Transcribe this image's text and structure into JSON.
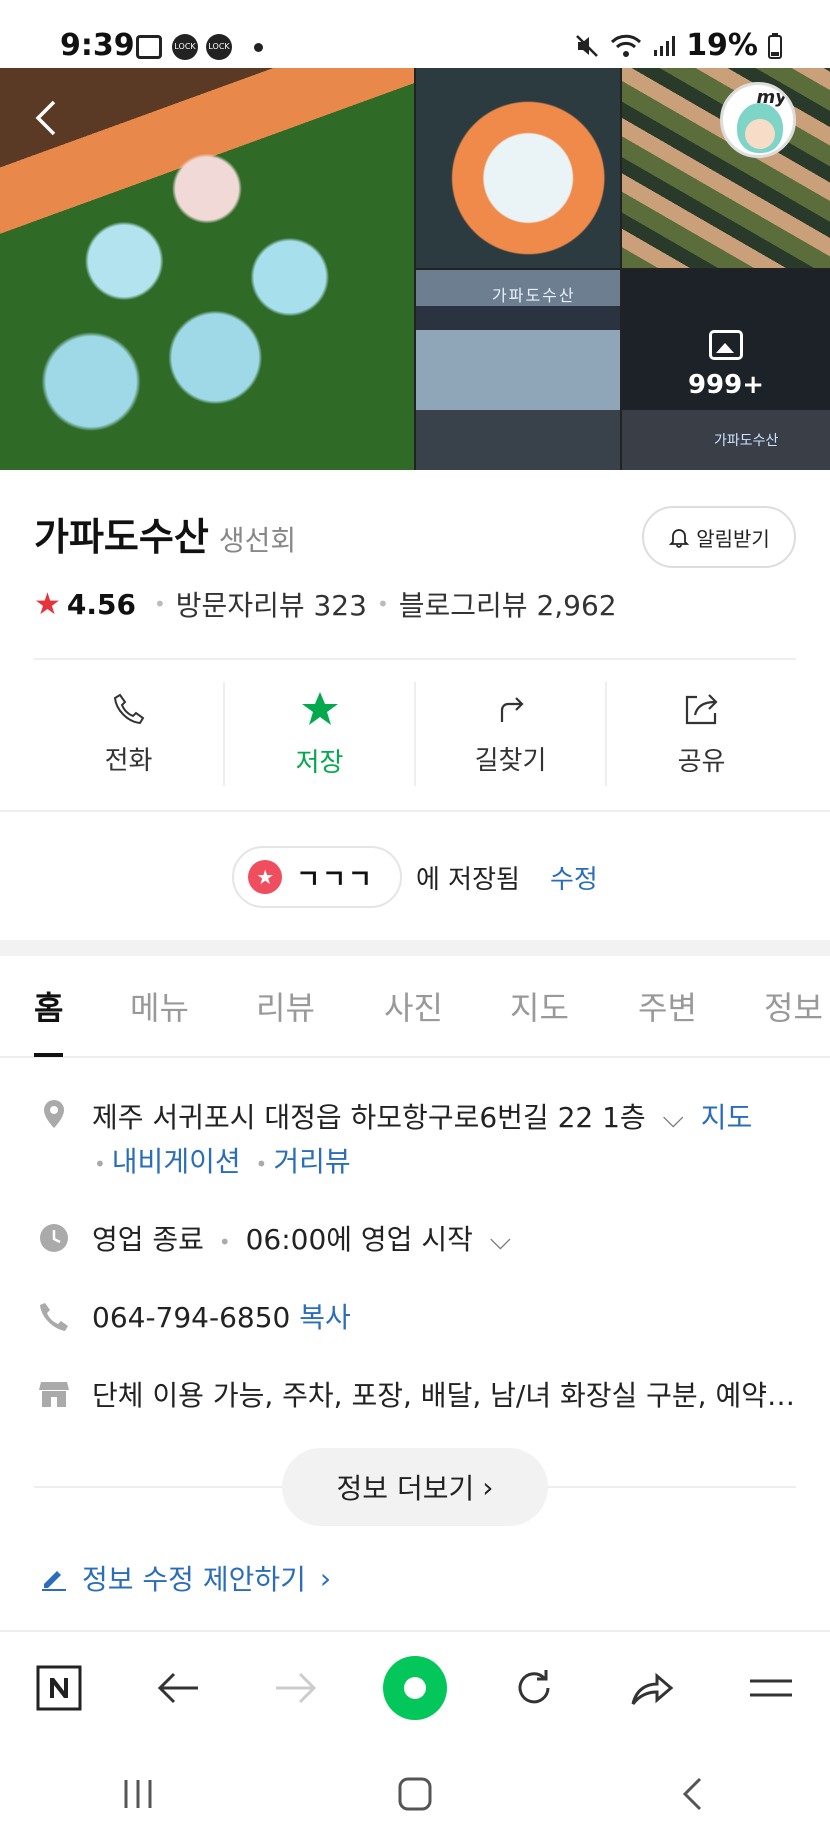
{
  "status_bar": {
    "time": "9:39",
    "lock_icon_text": "잠금",
    "battery": "19%"
  },
  "gallery": {
    "photo_count": "999+",
    "sign_text": "가파도수산",
    "my_label": "my"
  },
  "place": {
    "name": "가파도수산",
    "category": "생선회",
    "notify_label": "알림받기",
    "rating": "4.56",
    "visitor_reviews": "방문자리뷰 323",
    "blog_reviews": "블로그리뷰 2,962"
  },
  "actions": [
    {
      "label": "전화",
      "icon": "phone-icon"
    },
    {
      "label": "저장",
      "icon": "star-icon"
    },
    {
      "label": "길찾기",
      "icon": "directions-icon"
    },
    {
      "label": "공유",
      "icon": "share-icon"
    }
  ],
  "saved": {
    "list_name": "ㄱㄱㄱ",
    "saved_text": "에 저장됨",
    "edit_label": "수정"
  },
  "tabs": [
    "홈",
    "메뉴",
    "리뷰",
    "사진",
    "지도",
    "주변",
    "정보"
  ],
  "info": {
    "address": "제주 서귀포시 대정읍 하모항구로6번길 22 1층",
    "map_link": "지도",
    "navigation_link": "내비게이션",
    "street_view_link": "거리뷰",
    "hours_status": "영업 종료",
    "hours_next": "06:00에 영업 시작",
    "phone": "064-794-6850",
    "copy_link": "복사",
    "amenities": "단체 이용 가능, 주차, 포장, 배달, 남/녀 화장실 구분, 예약…",
    "more_info_label": "정보 더보기",
    "suggest_edit_label": "정보 수정 제안하기"
  },
  "colors": {
    "accent_green": "#03c75a",
    "link_blue": "#2a6ebb",
    "rating_red": "#e8323c"
  }
}
